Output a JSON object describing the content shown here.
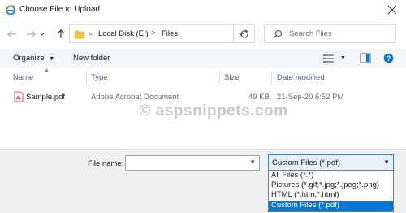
{
  "window": {
    "title": "Choose File to Upload"
  },
  "address": {
    "overflow": "«",
    "drive": "Local Disk (E:)",
    "separator": ">",
    "folder": "Files"
  },
  "search": {
    "placeholder": "Search Files"
  },
  "toolbar": {
    "organize": "Organize",
    "new_folder": "New folder"
  },
  "columns": [
    "Name",
    "Type",
    "Size",
    "Date modified"
  ],
  "files": [
    {
      "name": "Sample.pdf",
      "type": "Adobe Acrobat Document",
      "size": "49 KB",
      "date": "21-Sep-20 6:52 PM"
    }
  ],
  "watermark": "© aspsnippets.com",
  "file_name": {
    "label": "File name:",
    "value": ""
  },
  "filter": {
    "selected": "Custom Files (*.pdf)",
    "options": [
      "All Files (*.*)",
      "Pictures (*.gif;*.jpg;*.jpeg;*.png)",
      "HTML (*.htm;*.html)",
      "Custom Files (*.pdf)"
    ]
  },
  "colors": {
    "accent": "#0078d7",
    "folder": "#f0c24c",
    "pdf": "#c62b2b"
  }
}
